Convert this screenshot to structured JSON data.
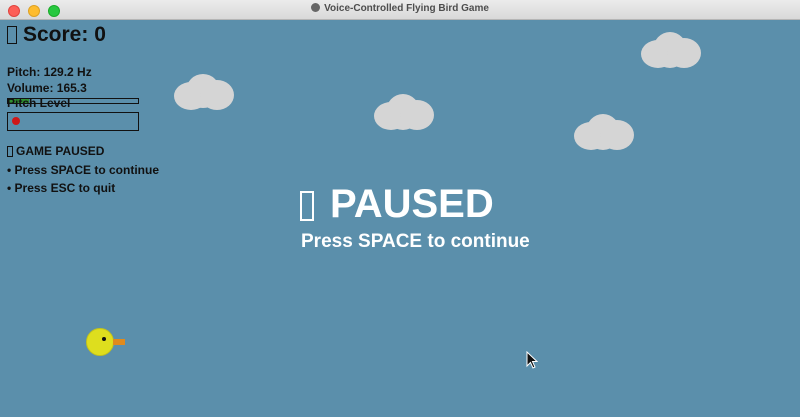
{
  "window": {
    "title": "Voice-Controlled Flying Bird Game"
  },
  "hud": {
    "score_label": "Score: 0",
    "pitch_label": "Pitch: 129.2 Hz",
    "volume_label": "Volume: 165.3",
    "pitch_level_label": "Pitch Level",
    "volume_fill_fraction": 0.16,
    "paused_label": "GAME PAUSED",
    "instructions": [
      "• Press SPACE to continue",
      "• Press ESC to quit"
    ]
  },
  "overlay": {
    "title": "PAUSED",
    "subtitle": "Press SPACE to continue"
  },
  "icons": {
    "score": "unknown-glyph-icon",
    "paused": "unknown-glyph-icon",
    "overlay": "unknown-glyph-icon"
  },
  "colors": {
    "sky": "#5b8fab",
    "cloud": "#d5d5d5",
    "bird": "#dede1e",
    "beak": "#e08a1c",
    "volume_bar": "#2f8f2f",
    "pitch_marker": "#d01818"
  }
}
